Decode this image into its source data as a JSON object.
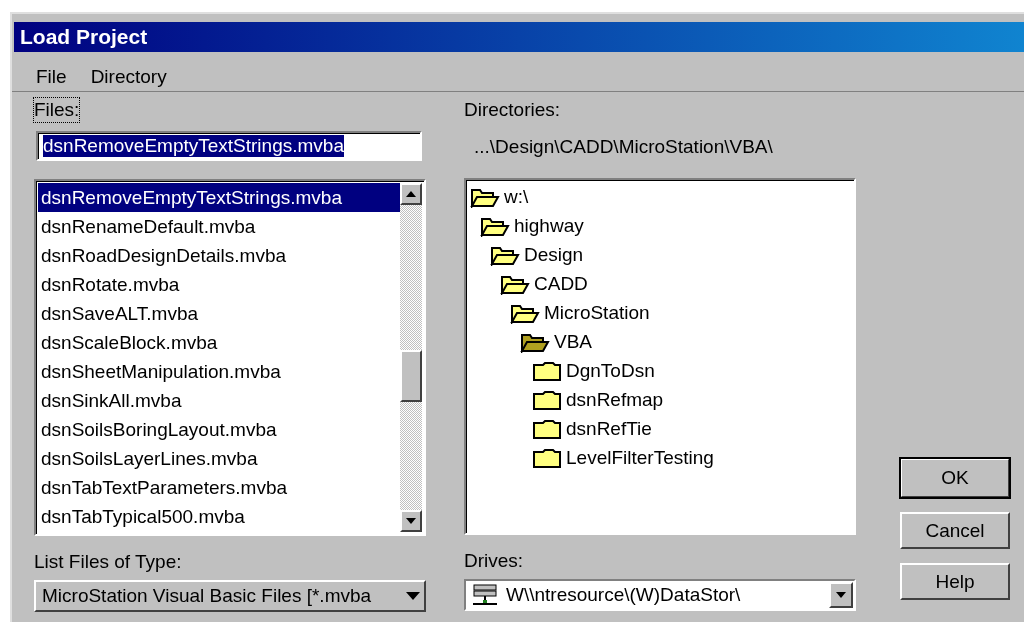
{
  "window": {
    "title": "Load Project"
  },
  "menu": [
    {
      "label": "File"
    },
    {
      "label": "Directory"
    }
  ],
  "files": {
    "label": "Files:",
    "value": "dsnRemoveEmptyTextStrings.mvba",
    "items": [
      {
        "name": "dsnRemoveEmptyTextStrings.mvba",
        "selected": true
      },
      {
        "name": "dsnRenameDefault.mvba",
        "selected": false
      },
      {
        "name": "dsnRoadDesignDetails.mvba",
        "selected": false
      },
      {
        "name": "dsnRotate.mvba",
        "selected": false
      },
      {
        "name": "dsnSaveALT.mvba",
        "selected": false
      },
      {
        "name": "dsnScaleBlock.mvba",
        "selected": false
      },
      {
        "name": "dsnSheetManipulation.mvba",
        "selected": false
      },
      {
        "name": "dsnSinkAll.mvba",
        "selected": false
      },
      {
        "name": "dsnSoilsBoringLayout.mvba",
        "selected": false
      },
      {
        "name": "dsnSoilsLayerLines.mvba",
        "selected": false
      },
      {
        "name": "dsnTabTextParameters.mvba",
        "selected": false
      },
      {
        "name": "dsnTabTypical500.mvba",
        "selected": false
      }
    ]
  },
  "file_type": {
    "label": "List Files of Type:",
    "value": "MicroStation Visual Basic Files [*.mvba"
  },
  "directories": {
    "label": "Directories:",
    "path": "...\\Design\\CADD\\MicroStation\\VBA\\",
    "tree": [
      {
        "name": "w:\\",
        "expanded": true,
        "selected": false,
        "children": [
          {
            "name": "highway",
            "expanded": true,
            "selected": false,
            "children": [
              {
                "name": "Design",
                "expanded": true,
                "selected": false,
                "children": [
                  {
                    "name": "CADD",
                    "expanded": true,
                    "selected": false,
                    "children": [
                      {
                        "name": "MicroStation",
                        "expanded": true,
                        "selected": false,
                        "children": [
                          {
                            "name": "VBA",
                            "expanded": true,
                            "selected": true,
                            "children": [
                              {
                                "name": "DgnToDsn",
                                "expanded": false,
                                "selected": false
                              },
                              {
                                "name": "dsnRefmap",
                                "expanded": false,
                                "selected": false
                              },
                              {
                                "name": "dsnRefTie",
                                "expanded": false,
                                "selected": false
                              },
                              {
                                "name": "LevelFilterTesting",
                                "expanded": false,
                                "selected": false
                              }
                            ]
                          }
                        ]
                      }
                    ]
                  }
                ]
              }
            ]
          }
        ]
      }
    ]
  },
  "drives": {
    "label": "Drives:",
    "value": "W\\\\ntresource\\(W)DataStor\\"
  },
  "buttons": [
    {
      "label": "OK",
      "default": true
    },
    {
      "label": "Cancel",
      "default": false
    },
    {
      "label": "Help",
      "default": false
    }
  ]
}
